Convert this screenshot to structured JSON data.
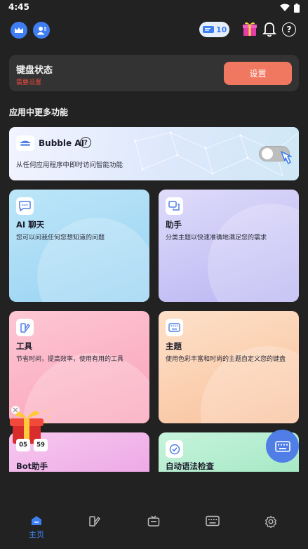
{
  "status_bar": {
    "time": "4:45"
  },
  "topbar": {
    "coin_count": "10",
    "icons": [
      "crown-icon",
      "profile-icon",
      "gift-icon",
      "bell-icon",
      "help-icon"
    ]
  },
  "keyboard_status": {
    "title": "键盘状态",
    "subtitle": "需要设置",
    "button_label": "设置"
  },
  "section_title": "应用中更多功能",
  "bubble_ai": {
    "title": "Bubble AI",
    "help": "?",
    "description": "从任何应用程序中即时访问智能功能"
  },
  "features": [
    {
      "title": "AI 聊天",
      "description": "您可以问我任何您想知道的问题"
    },
    {
      "title": "助手",
      "description": "分类主题以快速准确地满足您的需求"
    },
    {
      "title": "工具",
      "description": "节省时间，提高效率，使用有用的工具"
    },
    {
      "title": "主题",
      "description": "使用色彩丰富和时尚的主题自定义您的键盘"
    },
    {
      "title": "Bot助手",
      "description": ""
    },
    {
      "title": "自动语法检查",
      "description": ""
    }
  ],
  "promo": {
    "timer_min": "05",
    "timer_sec": "59"
  },
  "bottom_nav": {
    "home_label": "主页"
  },
  "colors": {
    "accent": "#3e7ef2",
    "setup_button": "#f07860",
    "warning_text": "#e84a3f",
    "background": "#222222"
  }
}
